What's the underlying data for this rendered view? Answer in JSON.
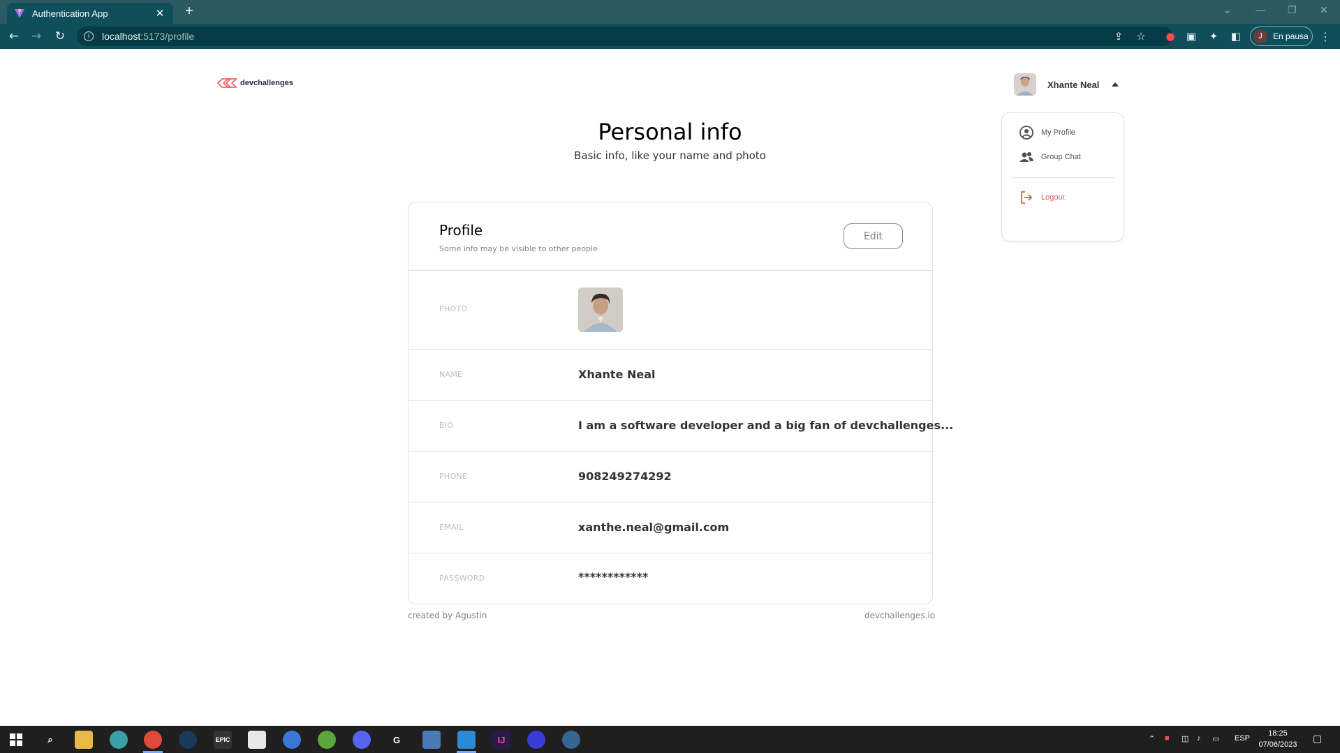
{
  "browser": {
    "tab_title": "Authentication App",
    "tab_close": "✕",
    "new_tab": "+",
    "url_host": "localhost",
    "url_path": ":5173/profile",
    "profile_initial": "J",
    "profile_status": "En pausa"
  },
  "header": {
    "logo_text": "devchallenges",
    "user_name": "Xhante Neal"
  },
  "dropdown": {
    "items": [
      {
        "label": "My Profile",
        "icon": "user-circle-icon"
      },
      {
        "label": "Group Chat",
        "icon": "group-icon"
      },
      {
        "label": "Logout",
        "icon": "logout-icon"
      }
    ]
  },
  "page": {
    "title": "Personal info",
    "subtitle": "Basic info, like your name and photo"
  },
  "profile_card": {
    "title": "Profile",
    "subtitle": "Some info may be visible to other people",
    "edit_label": "Edit",
    "rows": [
      {
        "label": "PHOTO",
        "value": ""
      },
      {
        "label": "NAME",
        "value": "Xhante Neal"
      },
      {
        "label": "BIO",
        "value": "I am a software developer and a big fan of devchallenges..."
      },
      {
        "label": "PHONE",
        "value": "908249274292"
      },
      {
        "label": "EMAIL",
        "value": "xanthe.neal@gmail.com"
      },
      {
        "label": "PASSWORD",
        "value": "************"
      }
    ]
  },
  "footer": {
    "left": "created by Agustin",
    "right": "devchallenges.io"
  },
  "taskbar": {
    "language": "ESP",
    "time": "18:25",
    "date": "07/06/2023"
  },
  "colors": {
    "browser_tabbar": "#2c5a63",
    "browser_toolbar": "#0f4f5c",
    "logout_red": "#eb5757",
    "border": "#e0e0e0",
    "taskbar": "#1f1f1f"
  }
}
